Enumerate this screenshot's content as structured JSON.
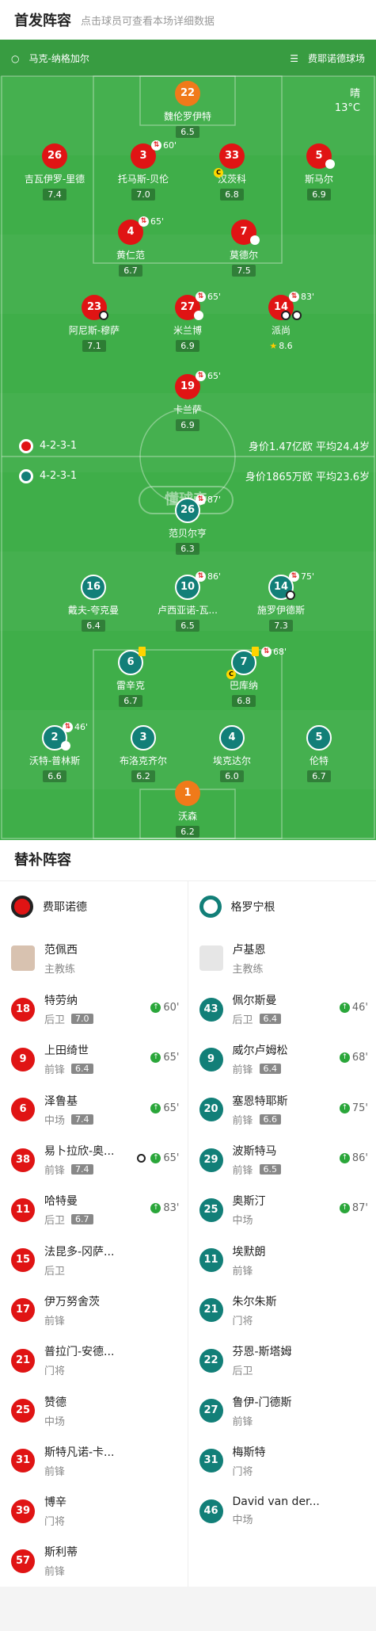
{
  "header": {
    "title": "首发阵容",
    "subtitle": "点击球员可查看本场详细数据"
  },
  "venue": {
    "referee": "马克-纳格加尔",
    "stadium": "费耶诺德球场"
  },
  "weather": {
    "condition": "晴",
    "temp": "13°C"
  },
  "home": {
    "formation": "4-2-3-1",
    "value": "身价1.47亿欧",
    "age": "平均24.4岁",
    "color": "#e01414"
  },
  "away": {
    "formation": "4-2-3-1",
    "value": "身价1865万欧",
    "age": "平均23.6岁",
    "color": "#127f78"
  },
  "watermark": "懂球帝",
  "home_players": [
    {
      "num": "22",
      "name": "魏伦罗伊特",
      "rating": "6.5"
    },
    {
      "num": "26",
      "name": "吉瓦伊罗-里德",
      "rating": "7.4"
    },
    {
      "num": "3",
      "name": "托马斯-贝伦",
      "rating": "7.0",
      "sub": "60'"
    },
    {
      "num": "33",
      "name": "汉茨科",
      "rating": "6.8"
    },
    {
      "num": "5",
      "name": "斯马尔",
      "rating": "6.9"
    },
    {
      "num": "4",
      "name": "黄仁范",
      "rating": "6.7",
      "sub": "65'"
    },
    {
      "num": "7",
      "name": "莫德尔",
      "rating": "7.5"
    },
    {
      "num": "23",
      "name": "阿尼斯-穆萨",
      "rating": "7.1"
    },
    {
      "num": "27",
      "name": "米兰博",
      "rating": "6.9",
      "sub": "65'"
    },
    {
      "num": "14",
      "name": "派尚",
      "rating": "8.6",
      "sub": "83'"
    },
    {
      "num": "19",
      "name": "卡兰萨",
      "rating": "6.9",
      "sub": "65'"
    }
  ],
  "away_players": [
    {
      "num": "26",
      "name": "范贝尔亨",
      "rating": "6.3",
      "sub": "87'"
    },
    {
      "num": "16",
      "name": "戴夫-夸克曼",
      "rating": "6.4"
    },
    {
      "num": "10",
      "name": "卢西亚诺-瓦...",
      "rating": "6.5",
      "sub": "86'"
    },
    {
      "num": "14",
      "name": "施罗伊德斯",
      "rating": "7.3",
      "sub": "75'"
    },
    {
      "num": "6",
      "name": "雷辛克",
      "rating": "6.7"
    },
    {
      "num": "7",
      "name": "巴库纳",
      "rating": "6.8",
      "sub": "68'"
    },
    {
      "num": "2",
      "name": "沃特-普林斯",
      "rating": "6.6",
      "sub": "46'"
    },
    {
      "num": "3",
      "name": "布洛克齐尔",
      "rating": "6.2"
    },
    {
      "num": "4",
      "name": "埃克达尔",
      "rating": "6.0"
    },
    {
      "num": "5",
      "name": "伦特",
      "rating": "6.7"
    },
    {
      "num": "1",
      "name": "沃森",
      "rating": "6.2"
    }
  ],
  "subs": {
    "title": "替补阵容",
    "home_team": "费耶诺德",
    "away_team": "格罗宁根",
    "home_coach": {
      "name": "范佩西",
      "role": "主教练"
    },
    "away_coach": {
      "name": "卢基恩",
      "role": "主教练"
    },
    "home": [
      {
        "num": "18",
        "name": "特劳纳",
        "pos": "后卫",
        "rating": "7.0",
        "min": "60'"
      },
      {
        "num": "9",
        "name": "上田绮世",
        "pos": "前锋",
        "rating": "6.4",
        "min": "65'"
      },
      {
        "num": "6",
        "name": "泽鲁基",
        "pos": "中场",
        "rating": "7.4",
        "min": "65'"
      },
      {
        "num": "38",
        "name": "易卜拉欣-奥...",
        "pos": "前锋",
        "rating": "7.4",
        "min": "65'"
      },
      {
        "num": "11",
        "name": "哈特曼",
        "pos": "后卫",
        "rating": "6.7",
        "min": "83'"
      },
      {
        "num": "15",
        "name": "法昆多-冈萨...",
        "pos": "后卫"
      },
      {
        "num": "17",
        "name": "伊万努舍茨",
        "pos": "前锋"
      },
      {
        "num": "21",
        "name": "普拉门-安德...",
        "pos": "门将"
      },
      {
        "num": "25",
        "name": "赞德",
        "pos": "中场"
      },
      {
        "num": "31",
        "name": "斯特凡诺-卡...",
        "pos": "前锋"
      },
      {
        "num": "39",
        "name": "博辛",
        "pos": "门将"
      },
      {
        "num": "57",
        "name": "斯利蒂",
        "pos": "前锋"
      }
    ],
    "away": [
      {
        "num": "43",
        "name": "佩尔斯曼",
        "pos": "后卫",
        "rating": "6.4",
        "min": "46'"
      },
      {
        "num": "9",
        "name": "威尔卢姆松",
        "pos": "前锋",
        "rating": "6.4",
        "min": "68'"
      },
      {
        "num": "20",
        "name": "塞恩特耶斯",
        "pos": "前锋",
        "rating": "6.6",
        "min": "75'"
      },
      {
        "num": "29",
        "name": "波斯特马",
        "pos": "前锋",
        "rating": "6.5",
        "min": "86'"
      },
      {
        "num": "25",
        "name": "奥斯汀",
        "pos": "中场",
        "min": "87'"
      },
      {
        "num": "11",
        "name": "埃默朗",
        "pos": "前锋"
      },
      {
        "num": "21",
        "name": "朱尔朱斯",
        "pos": "门将"
      },
      {
        "num": "22",
        "name": "芬恩-斯塔姆",
        "pos": "后卫"
      },
      {
        "num": "27",
        "name": "鲁伊-门德斯",
        "pos": "前锋"
      },
      {
        "num": "31",
        "name": "梅斯特",
        "pos": "门将"
      },
      {
        "num": "46",
        "name": "David van der...",
        "pos": "中场"
      }
    ]
  }
}
